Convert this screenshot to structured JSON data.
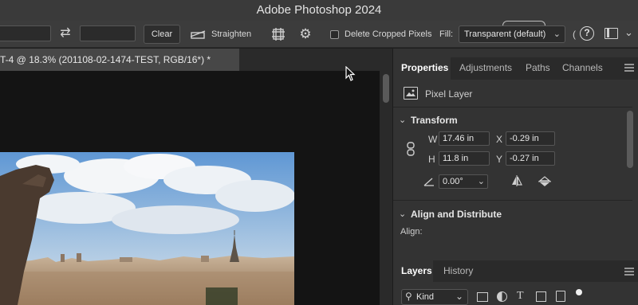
{
  "app": {
    "title": "Adobe Photoshop 2024"
  },
  "options_bar": {
    "clear_label": "Clear",
    "straighten_label": "Straighten",
    "delete_cropped_label": "Delete Cropped Pixels",
    "fill_label": "Fill:",
    "fill_value": "Transparent (default)",
    "help_glyph": "?",
    "overflow_glyph": "»"
  },
  "document": {
    "tab_title": "T-4 @ 18.3% (201108-02-1474-TEST, RGB/16*) *"
  },
  "properties": {
    "tabs": [
      "Properties",
      "Adjustments",
      "Paths",
      "Channels"
    ],
    "layer_type": "Pixel Layer",
    "transform_label": "Transform",
    "w_label": "W",
    "w_value": "17.46 in",
    "h_label": "H",
    "h_value": "11.8 in",
    "x_label": "X",
    "x_value": "-0.29 in",
    "y_label": "Y",
    "y_value": "-0.27 in",
    "angle_value": "0.00°",
    "align_label": "Align and Distribute",
    "align_sub": "Align:"
  },
  "layers": {
    "tabs": [
      "Layers",
      "History"
    ],
    "filter_kind": "Kind"
  },
  "colors": {
    "accent": "#4a8fe0",
    "panel_bg": "#333333",
    "canvas_bg": "#141414"
  }
}
